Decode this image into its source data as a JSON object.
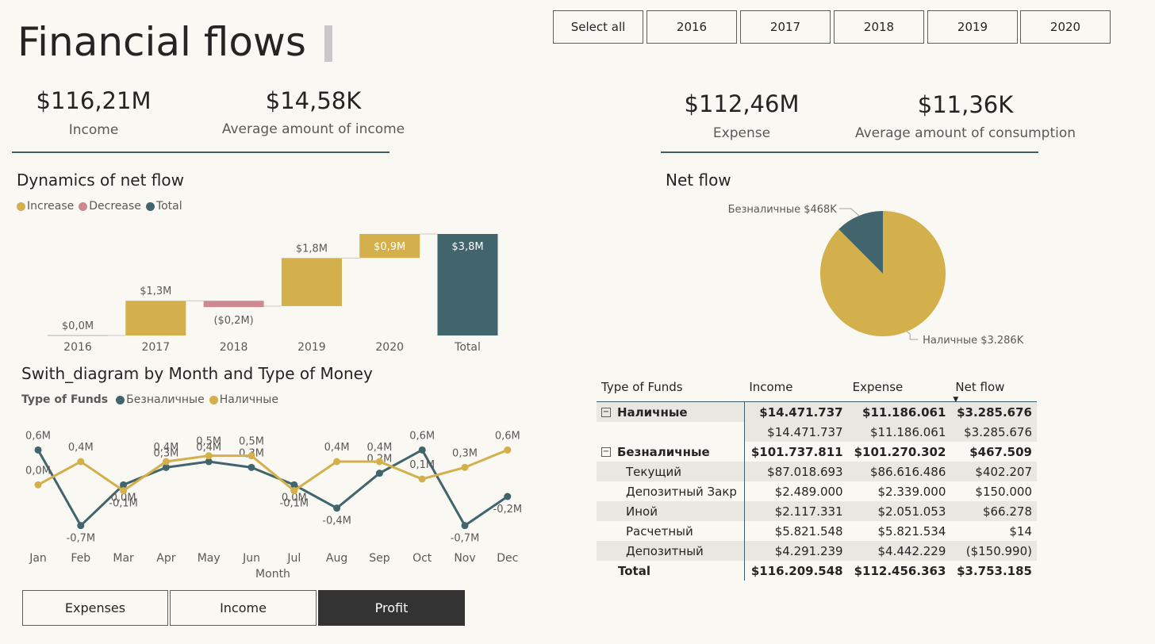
{
  "page": {
    "title": "Financial flows"
  },
  "year_slicer": {
    "items": [
      "Select all",
      "2016",
      "2017",
      "2018",
      "2019",
      "2020"
    ]
  },
  "kpis": {
    "income": {
      "value": "$116,21M",
      "label": "Income"
    },
    "avg_income": {
      "value": "$14,58K",
      "label": "Average amount of income"
    },
    "expense": {
      "value": "$112,46M",
      "label": "Expense"
    },
    "avg_consumption": {
      "value": "$11,36K",
      "label": "Average amount of consumption"
    }
  },
  "colors": {
    "increase": "#d4b04c",
    "decrease": "#cc8a90",
    "total": "#41646d",
    "accent_line": "#3f5d64"
  },
  "net_flow_dynamics": {
    "title": "Dynamics of net flow",
    "legend": [
      "Increase",
      "Decrease",
      "Total"
    ]
  },
  "switch_diagram": {
    "title": "Swith_diagram by Month and Type of Money",
    "legend_title": "Type of Funds",
    "legend": [
      "Безналичные",
      "Наличные"
    ]
  },
  "net_flow_pie": {
    "title": "Net flow"
  },
  "chart_data": [
    {
      "type": "bar",
      "subtype": "waterfall",
      "title": "Dynamics of net flow",
      "categories": [
        "2016",
        "2017",
        "2018",
        "2019",
        "2020",
        "Total"
      ],
      "values": [
        0.0,
        1.3,
        -0.2,
        1.8,
        0.9,
        3.8
      ],
      "kinds": [
        "increase",
        "increase",
        "decrease",
        "increase",
        "increase",
        "total"
      ],
      "labels": [
        "$0,0M",
        "$1,3M",
        "($0,2M)",
        "$1,8M",
        "$0,9M",
        "$3,8M"
      ],
      "legend": [
        "Increase",
        "Decrease",
        "Total"
      ],
      "ylim": [
        0,
        3.8
      ]
    },
    {
      "type": "line",
      "title": "Swith_diagram by Month and Type of Money",
      "xlabel": "Month",
      "ylabel": "",
      "categories": [
        "Jan",
        "Feb",
        "Mar",
        "Apr",
        "May",
        "Jun",
        "Jul",
        "Aug",
        "Sep",
        "Oct",
        "Nov",
        "Dec"
      ],
      "series": [
        {
          "name": "Безналичные",
          "values": [
            0.6,
            -0.7,
            0.0,
            0.3,
            0.4,
            0.3,
            0.0,
            -0.4,
            0.2,
            0.6,
            -0.7,
            -0.2
          ],
          "labels": [
            "0,6M",
            "-0,7M",
            "0,0M",
            "0,3M",
            "0,4M",
            "0,3M",
            "0,0M",
            "-0,4M",
            "0,2M",
            "0,6M",
            "-0,7M",
            "-0,2M"
          ]
        },
        {
          "name": "Наличные",
          "values": [
            0.0,
            0.4,
            -0.1,
            0.4,
            0.5,
            0.5,
            -0.1,
            0.4,
            0.4,
            0.1,
            0.3,
            0.6
          ],
          "labels": [
            "0,0M",
            "0,4M",
            "-0,1M",
            "0,4M",
            "0,5M",
            "0,5M",
            "-0,1M",
            "0,4M",
            "0,4M",
            "0,1M",
            "0,3M",
            "0,6M"
          ]
        }
      ],
      "ylim": [
        -0.8,
        0.7
      ]
    },
    {
      "type": "pie",
      "title": "Net flow",
      "categories": [
        "Наличные",
        "Безналичные"
      ],
      "values": [
        3286,
        468
      ],
      "labels": [
        "Наличные $3.286K",
        "Безналичные $468K"
      ]
    }
  ],
  "matrix": {
    "columns": [
      "Type of Funds",
      "Income",
      "Expense",
      "Net flow"
    ],
    "rows": [
      {
        "name": "Наличные",
        "income": "$14.471.737",
        "expense": "$11.186.061",
        "net": "$3.285.676"
      },
      {
        "name": "",
        "income": "$14.471.737",
        "expense": "$11.186.061",
        "net": "$3.285.676"
      },
      {
        "name": "Безналичные",
        "income": "$101.737.811",
        "expense": "$101.270.302",
        "net": "$467.509"
      },
      {
        "name": "Текущий",
        "income": "$87.018.693",
        "expense": "$86.616.486",
        "net": "$402.207"
      },
      {
        "name": "Депозитный Закр",
        "income": "$2.489.000",
        "expense": "$2.339.000",
        "net": "$150.000"
      },
      {
        "name": "Иной",
        "income": "$2.117.331",
        "expense": "$2.051.053",
        "net": "$66.278"
      },
      {
        "name": "Расчетный",
        "income": "$5.821.548",
        "expense": "$5.821.534",
        "net": "$14"
      },
      {
        "name": "Депозитный",
        "income": "$4.291.239",
        "expense": "$4.442.229",
        "net": "($150.990)"
      },
      {
        "name": "Total",
        "income": "$116.209.548",
        "expense": "$112.456.363",
        "net": "$3.753.185"
      }
    ]
  },
  "mode_buttons": {
    "items": [
      "Expenses",
      "Income",
      "Profit"
    ],
    "active": "Profit"
  }
}
